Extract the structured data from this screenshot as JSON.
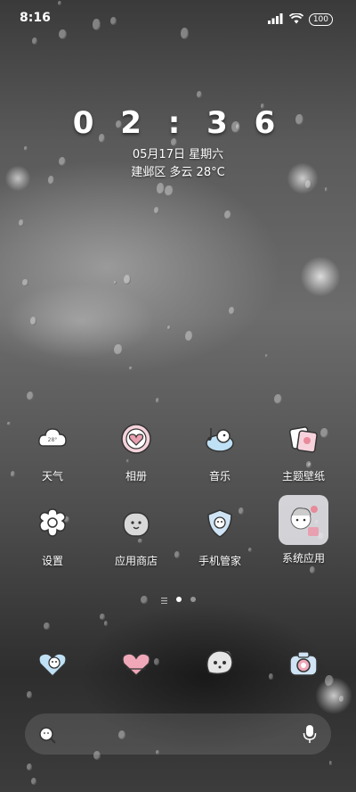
{
  "status": {
    "time": "8:16",
    "battery": "100"
  },
  "lockclock": {
    "time": "02:36",
    "date": "05月17日 星期六",
    "weather": "建邺区 多云 28°C"
  },
  "apps": [
    {
      "label": "天气",
      "icon": "weather-cloud-icon"
    },
    {
      "label": "相册",
      "icon": "gallery-heart-icon"
    },
    {
      "label": "音乐",
      "icon": "music-penguin-icon"
    },
    {
      "label": "主题壁纸",
      "icon": "theme-wallpaper-icon"
    },
    {
      "label": "设置",
      "icon": "settings-flower-icon"
    },
    {
      "label": "应用商店",
      "icon": "app-store-penguin-icon"
    },
    {
      "label": "手机管家",
      "icon": "security-shield-icon"
    },
    {
      "label": "系统应用",
      "icon": "system-apps-folder-icon"
    }
  ],
  "dock": [
    {
      "icon": "phone-heart-icon"
    },
    {
      "icon": "messages-heart-icon"
    },
    {
      "icon": "browser-bubble-icon"
    },
    {
      "icon": "camera-icon"
    }
  ],
  "colors": {
    "accent_pink": "#e8a0b0",
    "accent_blue": "#8fb6e0"
  }
}
